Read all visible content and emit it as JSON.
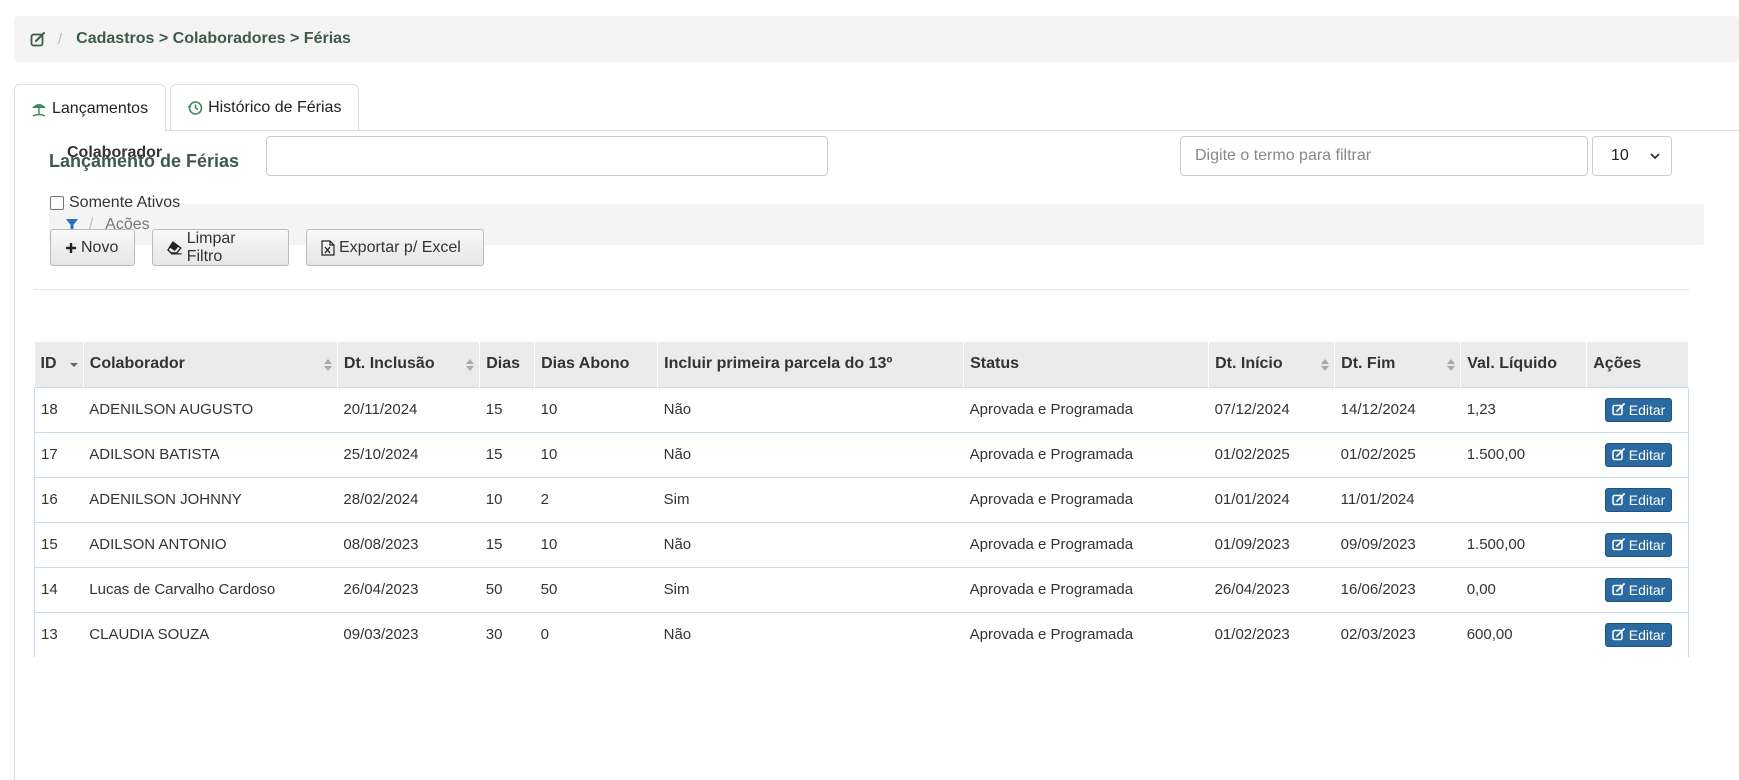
{
  "breadcrumb": {
    "path": "Cadastros > Colaboradores > Férias"
  },
  "tabs": [
    {
      "label": "Lançamentos",
      "icon": "beach-umbrella-icon",
      "active": true
    },
    {
      "label": "Histórico de Férias",
      "icon": "history-icon",
      "active": false
    }
  ],
  "panel": {
    "title": "Lançamento de Férias"
  },
  "filter_bar": {
    "label": "Ações"
  },
  "form": {
    "colaborador_label": "Colaborador",
    "colaborador_value": "",
    "search_placeholder": "Digite o termo para filtrar",
    "page_size": "10",
    "somente_ativos_label": "Somente Ativos",
    "somente_ativos_checked": false
  },
  "buttons": {
    "novo": "Novo",
    "limpar": "Limpar Filtro",
    "excel": "Exportar p/ Excel",
    "editar": "Editar"
  },
  "table": {
    "headers": [
      "ID",
      "Colaborador",
      "Dt. Inclusão",
      "Dias",
      "Dias Abono",
      "Incluir primeira parcela do 13º",
      "Status",
      "Dt. Início",
      "Dt. Fim",
      "Val. Líquido",
      "Ações"
    ],
    "rows": [
      [
        "18",
        "ADENILSON AUGUSTO",
        "20/11/2024",
        "15",
        "10",
        "Não",
        "Aprovada e Programada",
        "07/12/2024",
        "14/12/2024",
        "1,23"
      ],
      [
        "17",
        "ADILSON BATISTA",
        "25/10/2024",
        "15",
        "10",
        "Não",
        "Aprovada e Programada",
        "01/02/2025",
        "01/02/2025",
        "1.500,00"
      ],
      [
        "16",
        "ADENILSON JOHNNY",
        "28/02/2024",
        "10",
        "2",
        "Sim",
        "Aprovada e Programada",
        "01/01/2024",
        "11/01/2024",
        ""
      ],
      [
        "15",
        "ADILSON ANTONIO",
        "08/08/2023",
        "15",
        "10",
        "Não",
        "Aprovada e Programada",
        "01/09/2023",
        "09/09/2023",
        "1.500,00"
      ],
      [
        "14",
        "Lucas de Carvalho Cardoso",
        "26/04/2023",
        "50",
        "50",
        "Sim",
        "Aprovada e Programada",
        "26/04/2023",
        "16/06/2023",
        "0,00"
      ],
      [
        "13",
        "CLAUDIA SOUZA",
        "09/03/2023",
        "30",
        "0",
        "Não",
        "Aprovada e Programada",
        "01/02/2023",
        "02/03/2023",
        "600,00"
      ]
    ]
  },
  "colors": {
    "accent_green": "#3d5a4a",
    "edit_blue": "#2b6aa1",
    "filter_blue": "#2a73b8"
  }
}
